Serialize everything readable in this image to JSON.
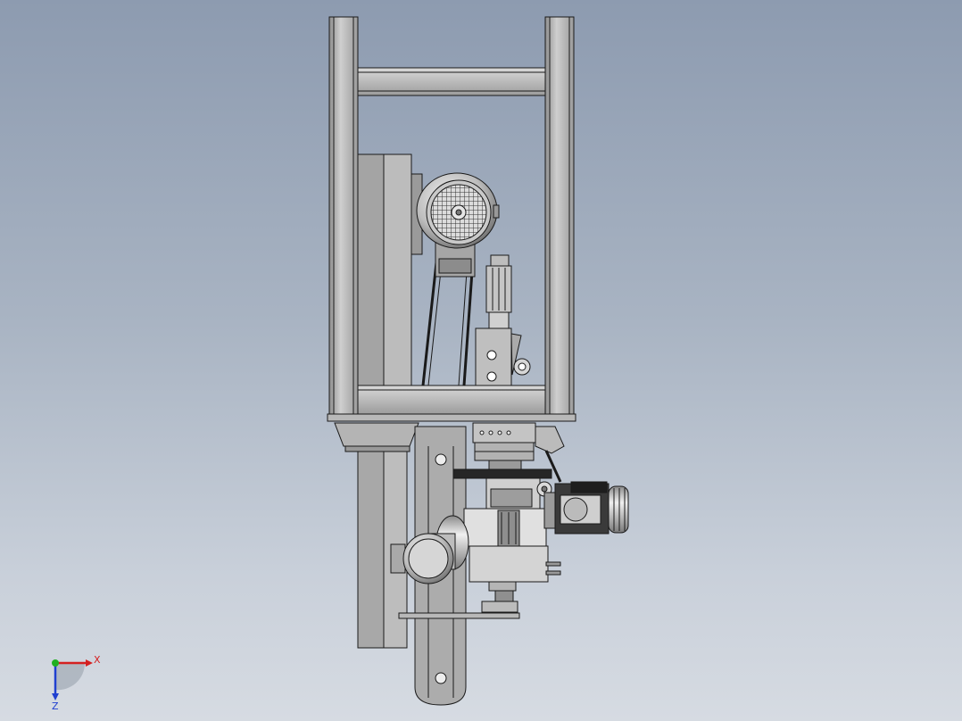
{
  "viewport": {
    "background_top": "#8d9bb0",
    "background_bottom": "#d6dbe2"
  },
  "triad": {
    "x_label": "X",
    "z_label": "Z",
    "x_color": "#d42020",
    "y_color": "#20b020",
    "z_color": "#2040d0"
  },
  "model": {
    "line_color": "#1a1a1a",
    "metal_light": "#c8c8c8",
    "metal_mid": "#a9a9a9",
    "metal_dark": "#7c7c7c"
  }
}
